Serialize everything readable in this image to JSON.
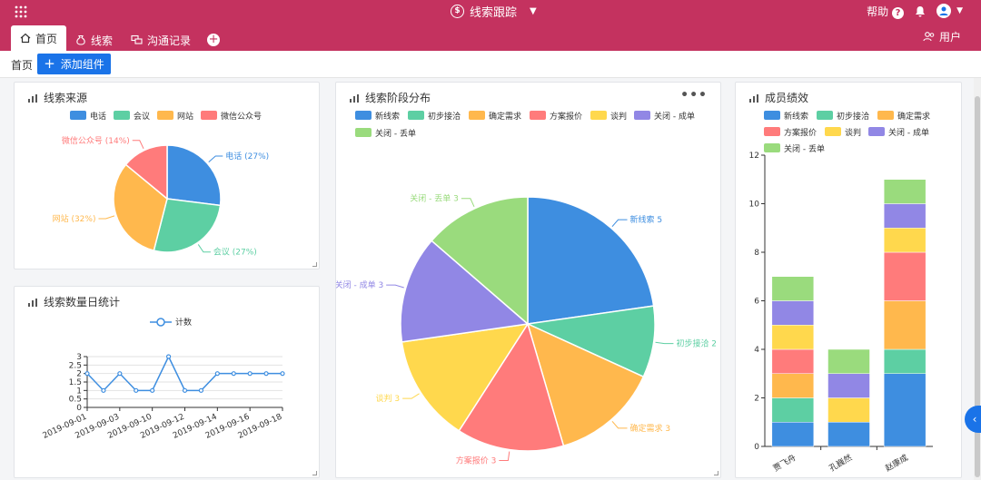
{
  "app": {
    "title": "线索跟踪"
  },
  "header": {
    "help_label": "帮助"
  },
  "tabs": [
    {
      "label": "首页",
      "icon": "home-icon"
    },
    {
      "label": "线索",
      "icon": "money-bag-icon"
    },
    {
      "label": "沟通记录",
      "icon": "chat-icon"
    }
  ],
  "users_label": "用户",
  "toolbar": {
    "breadcrumb": "首页",
    "add_widget_label": "添加组件"
  },
  "colors": {
    "topbar": "#c4325f",
    "accent": "#1a73e8",
    "palette": [
      "#3e8ee0",
      "#5dcfa3",
      "#ffb84d",
      "#ff7b7b",
      "#ffd84d",
      "#9187e5",
      "#9adb7d"
    ]
  },
  "chart_data": [
    {
      "id": "source",
      "type": "pie",
      "title": "线索来源",
      "legend": [
        "电话",
        "会议",
        "网站",
        "微信公众号"
      ],
      "slices": [
        {
          "name": "电话",
          "value": 27,
          "label": "电话 (27%)"
        },
        {
          "name": "会议",
          "value": 27,
          "label": "会议 (27%)"
        },
        {
          "name": "网站",
          "value": 32,
          "label": "网站 (32%)"
        },
        {
          "name": "微信公众号",
          "value": 14,
          "label": "微信公众号 (14%)"
        }
      ]
    },
    {
      "id": "stage",
      "type": "pie",
      "title": "线索阶段分布",
      "legend": [
        "新线索",
        "初步接洽",
        "确定需求",
        "方案报价",
        "谈判",
        "关闭 - 成单",
        "关闭 - 丢单"
      ],
      "slices": [
        {
          "name": "新线索",
          "value": 5,
          "label": "新线索 5"
        },
        {
          "name": "初步接洽",
          "value": 2,
          "label": "初步接洽 2"
        },
        {
          "name": "确定需求",
          "value": 3,
          "label": "确定需求 3"
        },
        {
          "name": "方案报价",
          "value": 3,
          "label": "方案报价 3"
        },
        {
          "name": "谈判",
          "value": 3,
          "label": "谈判 3"
        },
        {
          "name": "关闭 - 成单",
          "value": 3,
          "label": "关闭 - 成单 3"
        },
        {
          "name": "关闭 - 丢单",
          "value": 3,
          "label": "关闭 - 丢单 3"
        }
      ]
    },
    {
      "id": "daily",
      "type": "line",
      "title": "线索数量日统计",
      "series": [
        {
          "name": "计数",
          "values": [
            2,
            1,
            2,
            1,
            1,
            3,
            1,
            1,
            2,
            2,
            2,
            2,
            2
          ]
        }
      ],
      "x_ticks": [
        "2019-09-01",
        "2019-09-03",
        "2019-09-10",
        "2019-09-12",
        "2019-09-14",
        "2019-09-16",
        "2019-09-18"
      ],
      "ylim": [
        0,
        3
      ],
      "y_ticks": [
        "0",
        "0.5",
        "1",
        "1.5",
        "2",
        "2.5",
        "3"
      ]
    },
    {
      "id": "members",
      "type": "bar",
      "stacked": true,
      "title": "成员绩效",
      "categories": [
        "贾飞舟",
        "孔巍然",
        "赵康成"
      ],
      "series": [
        {
          "name": "新线索",
          "values": [
            1,
            1,
            3
          ]
        },
        {
          "name": "初步接洽",
          "values": [
            1,
            0,
            1
          ]
        },
        {
          "name": "确定需求",
          "values": [
            1,
            0,
            2
          ]
        },
        {
          "name": "方案报价",
          "values": [
            1,
            0,
            2
          ]
        },
        {
          "name": "谈判",
          "values": [
            1,
            1,
            1
          ]
        },
        {
          "name": "关闭 - 成单",
          "values": [
            1,
            1,
            1
          ]
        },
        {
          "name": "关闭 - 丢单",
          "values": [
            1,
            1,
            1
          ]
        }
      ],
      "ylim": [
        0,
        12
      ],
      "y_ticks": [
        "0",
        "2",
        "4",
        "6",
        "8",
        "10",
        "12"
      ]
    }
  ]
}
